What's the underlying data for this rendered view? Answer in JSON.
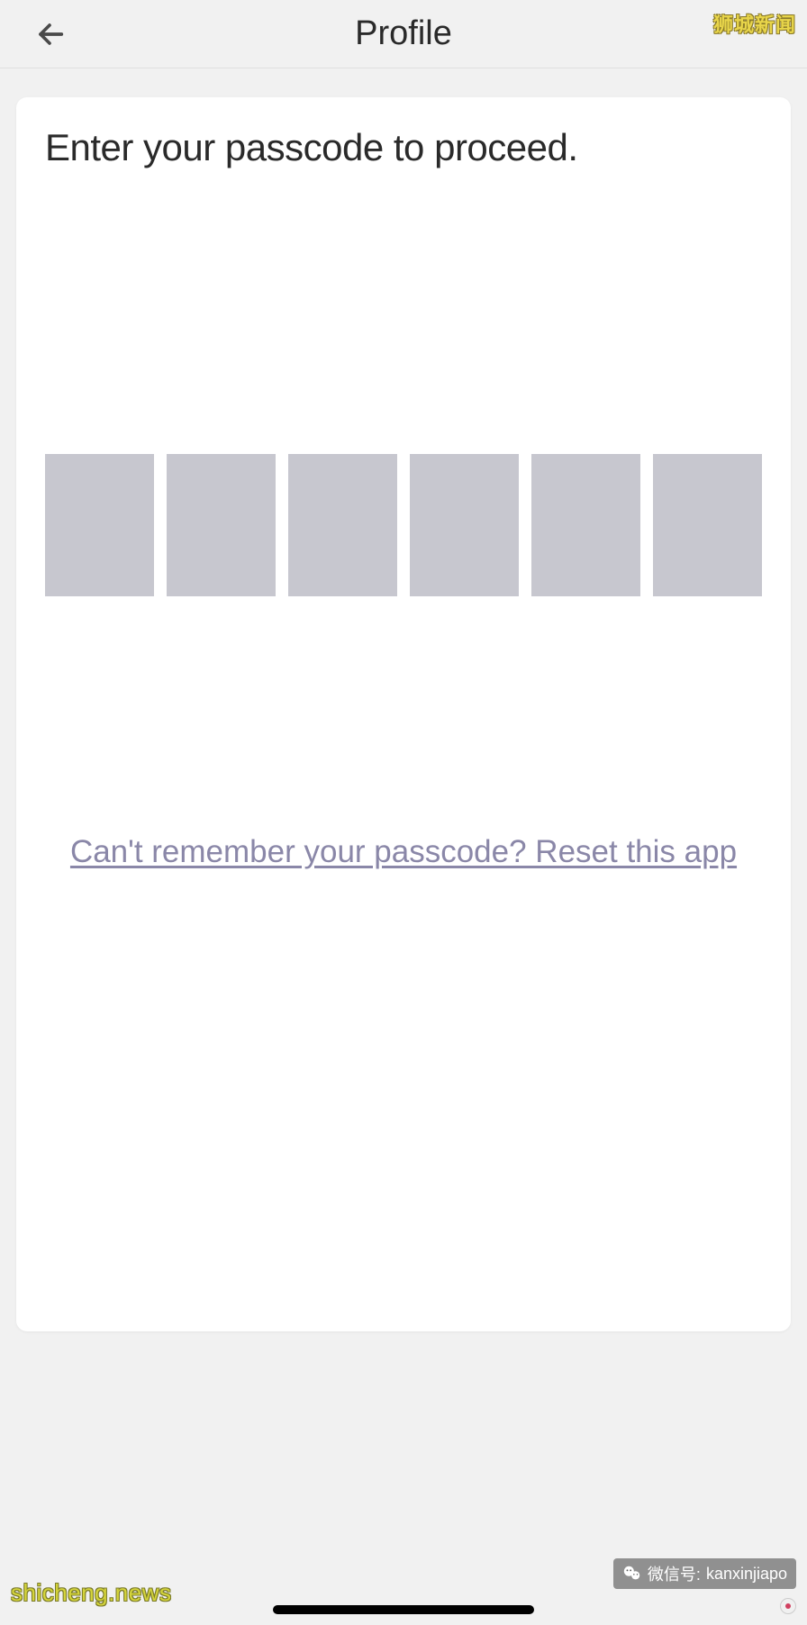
{
  "header": {
    "title": "Profile"
  },
  "watermarks": {
    "top_right": "狮城新闻",
    "bottom_left": "shicheng.news",
    "bottom_right_prefix": "微信号:",
    "bottom_right_id": "kanxinjiapo"
  },
  "card": {
    "heading": "Enter your passcode to proceed.",
    "reset_link": "Can't remember your passcode? Reset this app"
  },
  "passcode": {
    "digit_count": 6
  }
}
